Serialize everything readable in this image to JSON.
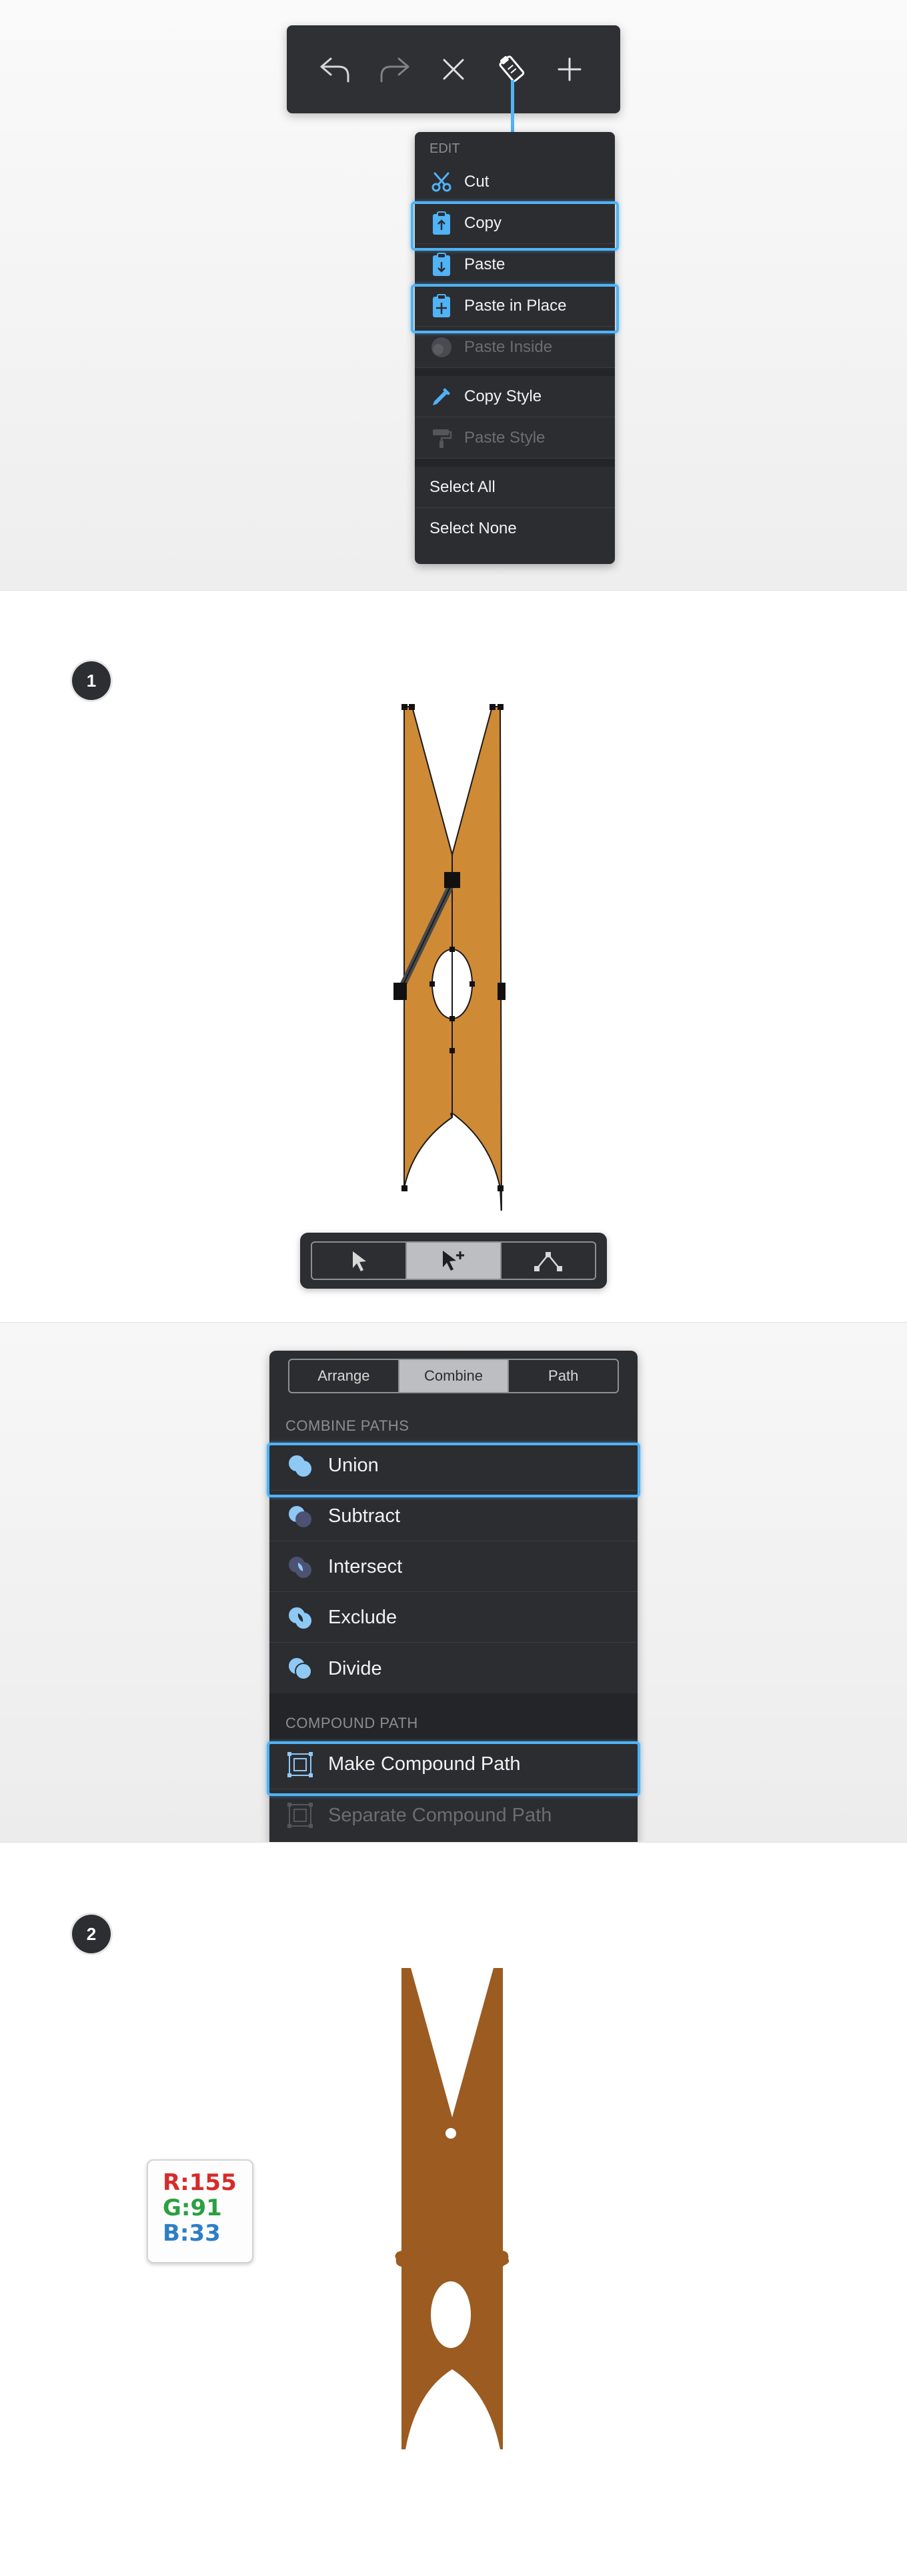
{
  "edit_toolbar": {
    "icons": [
      "undo-icon",
      "redo-icon",
      "close-icon",
      "clipboard-pencil-icon",
      "plus-icon"
    ]
  },
  "edit_menu": {
    "header": "EDIT",
    "items": [
      {
        "label": "Cut",
        "icon": "scissors-icon",
        "enabled": true,
        "highlighted": false
      },
      {
        "label": "Copy",
        "icon": "clipboard-copy-icon",
        "enabled": true,
        "highlighted": true
      },
      {
        "label": "Paste",
        "icon": "clipboard-paste-icon",
        "enabled": true,
        "highlighted": false
      },
      {
        "label": "Paste in Place",
        "icon": "clipboard-place-icon",
        "enabled": true,
        "highlighted": true
      },
      {
        "label": "Paste Inside",
        "icon": "circle-icon",
        "enabled": false,
        "highlighted": false
      },
      {
        "label": "Copy Style",
        "icon": "eyedropper-icon",
        "enabled": true,
        "highlighted": false
      },
      {
        "label": "Paste Style",
        "icon": "paint-roller-icon",
        "enabled": false,
        "highlighted": false
      },
      {
        "label": "Select All",
        "enabled": true,
        "highlighted": false
      },
      {
        "label": "Select None",
        "enabled": true,
        "highlighted": false
      }
    ]
  },
  "step1": {
    "badge": "1",
    "shape_fill": "#cf8a36",
    "tools": [
      "select-arrow-icon",
      "direct-select-plus-icon",
      "node-tool-icon"
    ],
    "active_tool_index": 1
  },
  "combine_panel": {
    "tabs": [
      "Arrange",
      "Combine",
      "Path"
    ],
    "active_tab": "Combine",
    "combine_label": "COMBINE PATHS",
    "combine_items": [
      {
        "label": "Union",
        "icon": "union-icon",
        "highlighted": true
      },
      {
        "label": "Subtract",
        "icon": "subtract-icon",
        "highlighted": false
      },
      {
        "label": "Intersect",
        "icon": "intersect-icon",
        "highlighted": false
      },
      {
        "label": "Exclude",
        "icon": "exclude-icon",
        "highlighted": false
      },
      {
        "label": "Divide",
        "icon": "divide-icon",
        "highlighted": false
      }
    ],
    "compound_label": "COMPOUND PATH",
    "compound_items": [
      {
        "label": "Make Compound Path",
        "icon": "compound-path-icon",
        "enabled": true,
        "highlighted": true
      },
      {
        "label": "Separate Compound Path",
        "icon": "separate-compound-icon",
        "enabled": false,
        "highlighted": false
      }
    ]
  },
  "step2": {
    "badge": "2",
    "shape_fill": "#9b5b21",
    "color": {
      "r": "R:155",
      "g": "G:91",
      "b": "B:33"
    }
  },
  "colors": {
    "accent": "#4fb3f6",
    "panel": "#2c2d31",
    "highlight_border": "#4fb3f6"
  }
}
